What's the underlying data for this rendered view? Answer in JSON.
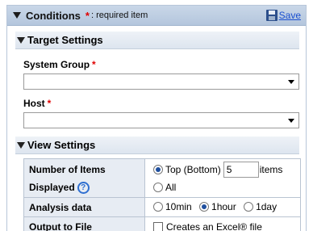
{
  "header": {
    "title": "Conditions",
    "required_star": "*",
    "required_note": ": required item",
    "save_label": "Save"
  },
  "target_settings": {
    "title": "Target Settings",
    "system_group_label": "System Group",
    "host_label": "Host",
    "required_star": "*",
    "system_group_value": "",
    "host_value": ""
  },
  "view_settings": {
    "title": "View Settings",
    "items_label_1": "Number of Items",
    "items_label_2": "Displayed",
    "help_glyph": "?",
    "top_option": "Top (Bottom)",
    "top_value": "5",
    "items_suffix": "items",
    "all_option": "All",
    "analysis_label": "Analysis data",
    "analysis_options": [
      "10min",
      "1hour",
      "1day"
    ],
    "analysis_selected": "1hour",
    "output_label": "Output to File",
    "excel_option": "Creates an Excel® file",
    "excel_checked": false,
    "count_mode": "top"
  }
}
